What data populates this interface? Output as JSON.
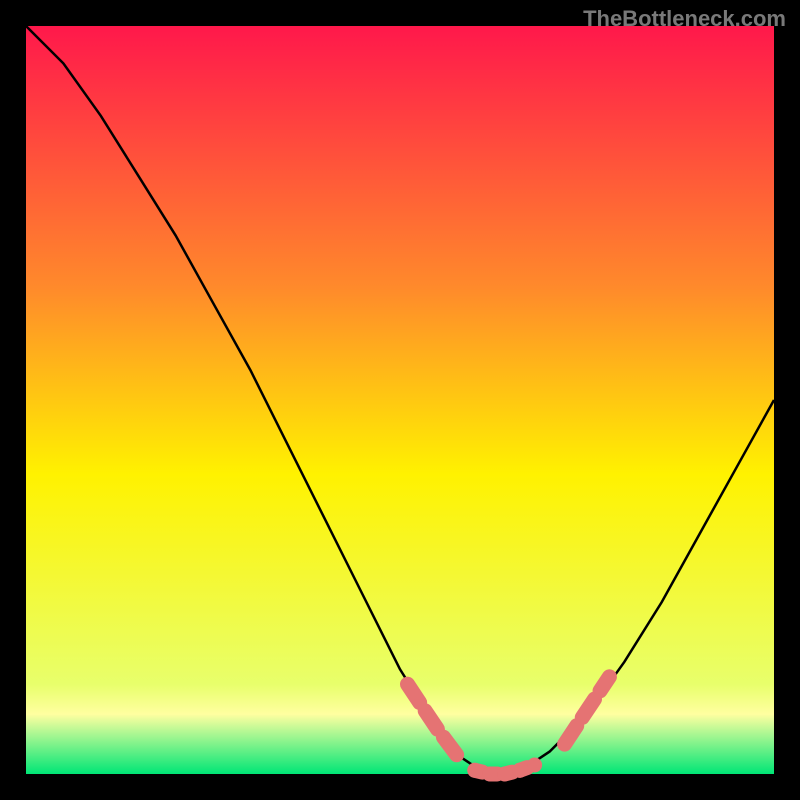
{
  "watermark": "TheBottleneck.com",
  "chart_data": {
    "type": "line",
    "title": "",
    "xlabel": "",
    "ylabel": "",
    "xlim": [
      0,
      100
    ],
    "ylim": [
      0,
      100
    ],
    "background_gradient": {
      "top": "#ff184b",
      "upper_mid": "#ff8a2b",
      "mid": "#fff200",
      "lower_mid": "#e8ff6b",
      "bottom": "#00e676"
    },
    "gradient_stops": [
      {
        "offset": 0,
        "color": "#ff184b"
      },
      {
        "offset": 35,
        "color": "#ff8a2b"
      },
      {
        "offset": 60,
        "color": "#fff200"
      },
      {
        "offset": 88,
        "color": "#e8ff6b"
      },
      {
        "offset": 92,
        "color": "#ffffa0"
      },
      {
        "offset": 100,
        "color": "#00e676"
      }
    ],
    "series": [
      {
        "name": "curve",
        "type": "line",
        "color": "#000000",
        "x": [
          0,
          5,
          10,
          15,
          20,
          25,
          30,
          35,
          40,
          45,
          50,
          55,
          57,
          60,
          63,
          65,
          67,
          70,
          75,
          80,
          85,
          90,
          95,
          100
        ],
        "y": [
          100,
          95,
          88,
          80,
          72,
          63,
          54,
          44,
          34,
          24,
          14,
          6,
          3,
          1,
          0,
          0,
          1,
          3,
          8,
          15,
          23,
          32,
          41,
          50
        ]
      },
      {
        "name": "highlight-left",
        "type": "thick-segment",
        "color": "#e57373",
        "x": [
          51,
          53,
          55,
          58
        ],
        "y": [
          12,
          9,
          6,
          2
        ]
      },
      {
        "name": "highlight-bottom",
        "type": "thick-dotted",
        "color": "#e57373",
        "x": [
          60,
          62,
          64,
          66,
          68
        ],
        "y": [
          0.5,
          0,
          0,
          0.5,
          1.2
        ]
      },
      {
        "name": "highlight-right",
        "type": "thick-segment",
        "color": "#e57373",
        "x": [
          72,
          74,
          76,
          78
        ],
        "y": [
          4,
          7,
          10,
          13
        ]
      }
    ],
    "border_color": "#000000",
    "border_width": 26
  }
}
